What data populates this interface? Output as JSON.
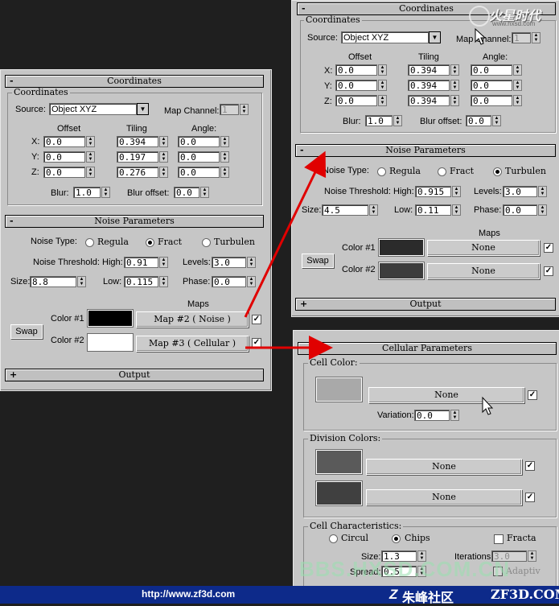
{
  "watermarks": {
    "top_logo": "火星时代",
    "top_url": "www.hxsd.com",
    "bbs": "BBS.HXSD.COM.CN"
  },
  "footer": {
    "url": "http://www.zf3d.com",
    "brand_cn": "朱峰社区",
    "brand_en": "ZF3D.COM"
  },
  "left": {
    "coordinates": {
      "rollout_sign": "-",
      "rollout_title": "Coordinates",
      "group_title": "Coordinates",
      "source_label": "Source:",
      "source_value": "Object XYZ",
      "map_channel_label": "Map Channel:",
      "map_channel_value": "1",
      "offset_header": "Offset",
      "tiling_header": "Tiling",
      "angle_header": "Angle:",
      "x_label": "X:",
      "y_label": "Y:",
      "z_label": "Z:",
      "offset": [
        "0.0",
        "0.0",
        "0.0"
      ],
      "tiling": [
        "0.394",
        "0.197",
        "0.276"
      ],
      "angle": [
        "0.0",
        "0.0",
        "0.0"
      ],
      "blur_label": "Blur:",
      "blur_value": "1.0",
      "blur_offset_label": "Blur offset:",
      "blur_offset_value": "0.0"
    },
    "noise": {
      "rollout_sign": "-",
      "rollout_title": "Noise Parameters",
      "noise_type_label": "Noise Type:",
      "types": [
        "Regula",
        "Fract",
        "Turbulen"
      ],
      "selected": 1,
      "threshold_label": "Noise Threshold:",
      "high_label": "High:",
      "high_value": "0.91",
      "levels_label": "Levels:",
      "levels_value": "3.0",
      "size_label": "Size:",
      "size_value": "8.8",
      "low_label": "Low:",
      "low_value": "0.115",
      "phase_label": "Phase:",
      "phase_value": "0.0",
      "maps_label": "Maps",
      "swap_label": "Swap",
      "color1_label": "Color #1",
      "color1": "#000000",
      "map1": "Map #2   ( Noise )",
      "color2_label": "Color #2",
      "color2": "#ffffff",
      "map2": "Map #3   ( Cellular )",
      "check": "✓"
    },
    "output": {
      "rollout_sign": "+",
      "rollout_title": "Output"
    }
  },
  "right_top": {
    "coordinates": {
      "rollout_sign": "-",
      "rollout_title": "Coordinates",
      "group_title": "Coordinates",
      "source_label": "Source:",
      "source_value": "Object XYZ",
      "map_channel_label": "Map Channel:",
      "map_channel_value": "1",
      "offset_header": "Offset",
      "tiling_header": "Tiling",
      "angle_header": "Angle:",
      "x_label": "X:",
      "y_label": "Y:",
      "z_label": "Z:",
      "offset": [
        "0.0",
        "0.0",
        "0.0"
      ],
      "tiling": [
        "0.394",
        "0.394",
        "0.394"
      ],
      "angle": [
        "0.0",
        "0.0",
        "0.0"
      ],
      "blur_label": "Blur:",
      "blur_value": "1.0",
      "blur_offset_label": "Blur offset:",
      "blur_offset_value": "0.0"
    },
    "noise": {
      "rollout_sign": "-",
      "rollout_title": "Noise Parameters",
      "noise_type_label": "Noise Type:",
      "types": [
        "Regula",
        "Fract",
        "Turbulen"
      ],
      "selected": 2,
      "threshold_label": "Noise Threshold:",
      "high_label": "High:",
      "high_value": "0.915",
      "levels_label": "Levels:",
      "levels_value": "3.0",
      "size_label": "Size:",
      "size_value": "4.5",
      "low_label": "Low:",
      "low_value": "0.11",
      "phase_label": "Phase:",
      "phase_value": "0.0",
      "maps_label": "Maps",
      "swap_label": "Swap",
      "color1_label": "Color #1",
      "color1": "#2b2b2b",
      "map1": "None",
      "color2_label": "Color #2",
      "color2": "#3c3c3c",
      "map2": "None",
      "check": "✓"
    },
    "output": {
      "rollout_sign": "+",
      "rollout_title": "Output"
    }
  },
  "cellular": {
    "rollout_sign": "-",
    "rollout_title": "Cellular Parameters",
    "cell_color_title": "Cell Color:",
    "cell_color": "#a9a9a9",
    "cell_map": "None",
    "variation_label": "Variation:",
    "variation_value": "0.0",
    "division_title": "Division Colors:",
    "div1_color": "#5a5a5a",
    "div1_map": "None",
    "div2_color": "#404040",
    "div2_map": "None",
    "characteristics_title": "Cell Characteristics:",
    "circular": "Circul",
    "chips": "Chips",
    "fractal": "Fracta",
    "size_label": "Size:",
    "size_value": "1.3",
    "iterations_label": "Iterations:",
    "iterations_value": "3.0",
    "spread_label": "Spread:",
    "spread_value": "0.5",
    "adaptive": "Adaptiv",
    "check": "✓"
  },
  "colors": {
    "arrow": "#e00000",
    "footer_bg": "#0d2a8a",
    "panel_bg": "#c6c6c6"
  }
}
